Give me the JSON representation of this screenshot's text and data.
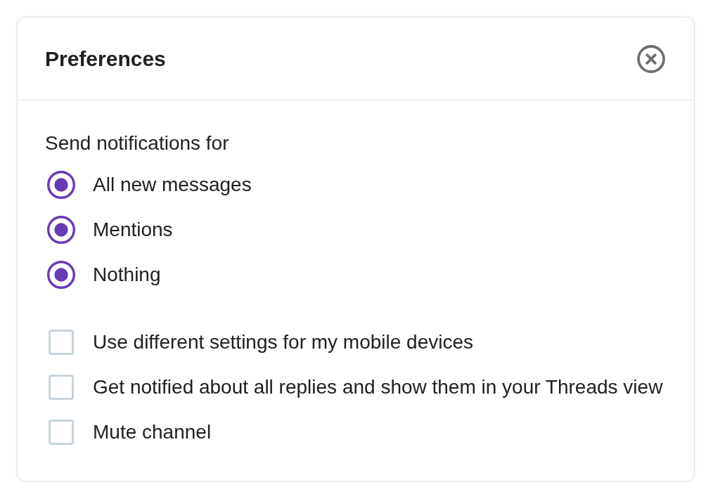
{
  "dialog": {
    "title": "Preferences"
  },
  "notifications": {
    "label": "Send notifications for",
    "options": [
      {
        "label": "All new messages",
        "selected": true
      },
      {
        "label": "Mentions",
        "selected": true
      },
      {
        "label": "Nothing",
        "selected": true
      }
    ]
  },
  "settings": [
    {
      "label": "Use different settings for my mobile devices",
      "checked": false
    },
    {
      "label": "Get notified about all replies and show them in your Threads view",
      "checked": false
    },
    {
      "label": "Mute channel",
      "checked": false
    }
  ]
}
